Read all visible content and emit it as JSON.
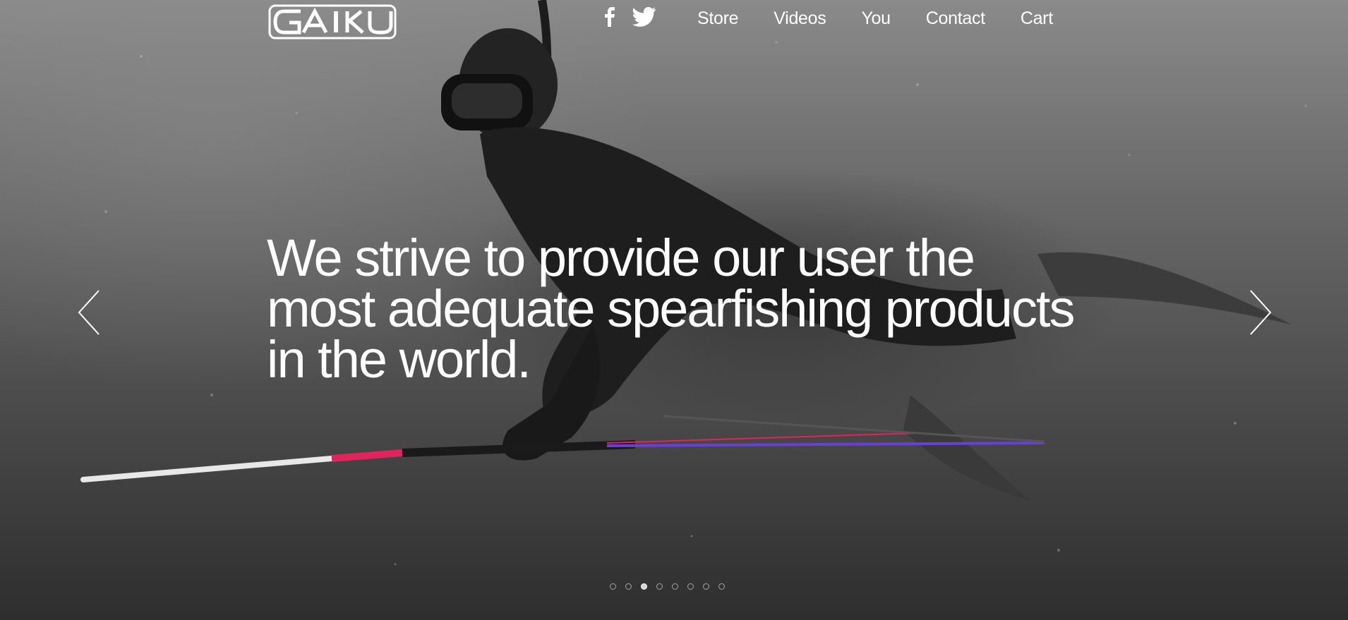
{
  "brand": {
    "logo_text": "GAIKU"
  },
  "nav": {
    "social": [
      {
        "icon": "facebook-icon"
      },
      {
        "icon": "twitter-icon"
      }
    ],
    "links": [
      "Store",
      "Videos",
      "You",
      "Contact",
      "Cart"
    ]
  },
  "hero": {
    "headline_lines": [
      "We strive to provide our user the",
      "most adequate spearfishing products",
      "in the world."
    ]
  },
  "carousel": {
    "slide_count": 8,
    "active_index": 2
  },
  "colors": {
    "accent_pink": "#e0245e",
    "accent_purple": "#6a3fd6",
    "text": "#ffffff"
  }
}
